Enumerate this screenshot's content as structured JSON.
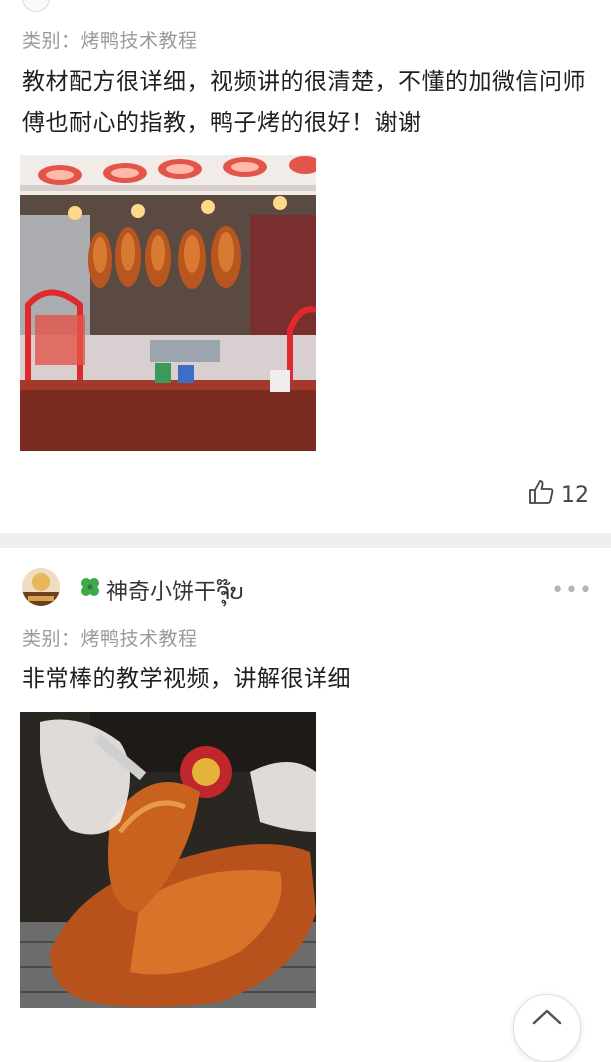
{
  "review1": {
    "category": "类别：烤鸭技术教程",
    "text": "教材配方很详细，视频讲的很清楚，不懂的加微信问师傅也耐心的指教，鸭子烤的很好！谢谢",
    "likes": "12"
  },
  "review2": {
    "username": "神奇小饼干ຈຸ໊ບ",
    "category": "类别：烤鸭技术教程",
    "text": "非常棒的教学视频，讲解很详细"
  },
  "colors": {
    "background": "#ffffff",
    "separator": "#efefef",
    "muted": "#9a9a9a"
  }
}
